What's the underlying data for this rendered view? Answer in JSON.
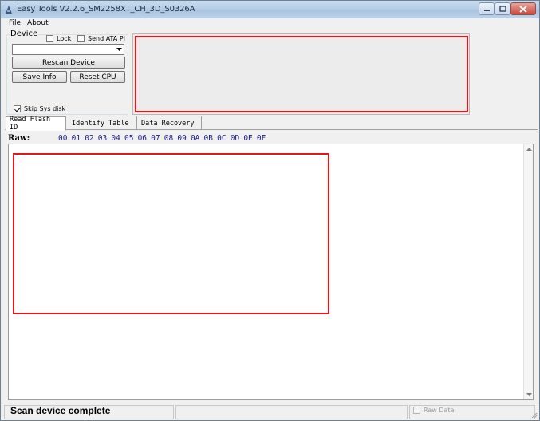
{
  "window": {
    "title": "Easy Tools V2.2.6_SM2258XT_CH_3D_S0326A",
    "icons": [
      "app-icon",
      "minimize-icon",
      "maximize-icon",
      "close-icon"
    ]
  },
  "menu": {
    "file": "File",
    "about": "About"
  },
  "device": {
    "legend": "Device",
    "lock_label": "Lock",
    "lock_checked": false,
    "send_ata_label": "Send ATA PI",
    "send_ata_checked": false,
    "selected_device": "",
    "rescan_label": "Rescan Device",
    "save_info_label": "Save Info",
    "reset_cpu_label": "Reset CPU",
    "skip_sys_label": "Skip Sys disk",
    "skip_sys_checked": true
  },
  "tabs": [
    {
      "label": "Read Flash ID",
      "active": true
    },
    {
      "label": "Identify Table",
      "active": false
    },
    {
      "label": "Data Recovery",
      "active": false
    }
  ],
  "hex_view": {
    "raw_label": "Raw:",
    "columns": [
      "00",
      "01",
      "02",
      "03",
      "04",
      "05",
      "06",
      "07",
      "08",
      "09",
      "0A",
      "0B",
      "0C",
      "0D",
      "0E",
      "0F"
    ]
  },
  "status": {
    "message": "Scan device complete",
    "raw_data_label": "Raw Data",
    "raw_data_checked": false
  },
  "colors": {
    "highlight_box": "#e8141a",
    "hex_header": "#1c1c8c"
  }
}
